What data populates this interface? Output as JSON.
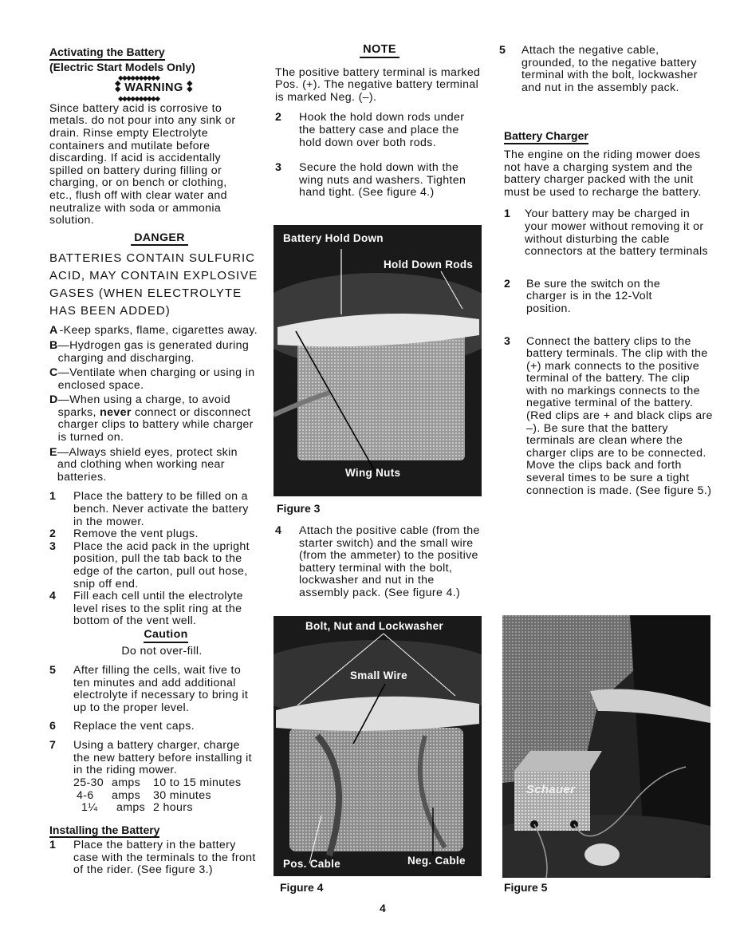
{
  "page_number": "4",
  "left_column": {
    "title": "Activating the Battery",
    "subtitle": "(Electric Start Models Only)",
    "warning_label": "WARNING",
    "warning_text": "Since battery acid is corrosive to metals. do not pour into any sink or drain. Rinse empty Electrolyte containers and mutilate before discarding. If acid is accidentally spilled on battery during filling or charging, or on bench or clothing, etc., flush off with clear water and neutralize with soda or ammonia solution.",
    "danger_label": "DANGER",
    "danger_text": "BATTERIES CONTAIN SULFURIC ACID, MAY CONTAIN EXPLOSIVE GASES (WHEN ELECTROLYTE HAS BEEN ADDED)",
    "danger_items": [
      {
        "letter": "A",
        "text": "-Keep sparks, flame, cigarettes away."
      },
      {
        "letter": "B",
        "text": "—Hydrogen gas is generated during charging and discharging."
      },
      {
        "letter": "C",
        "text": "—Ventilate when charging or using in enclosed space."
      },
      {
        "letter": "D",
        "text_before": "—When using a charge, to avoid sparks, ",
        "bold": "never",
        "text_after": " connect or disconnect charger clips to battery while charger is turned on."
      },
      {
        "letter": "E",
        "text": "—Always shield eyes, protect skin and clothing when working near batteries."
      }
    ],
    "steps": [
      {
        "num": "1",
        "text": "Place the battery to be filled on a bench. Never activate the battery in the mower."
      },
      {
        "num": "2",
        "text": "Remove the vent plugs."
      },
      {
        "num": "3",
        "text": "Place the acid pack in the upright position, pull the tab back to the edge of the carton, pull out hose, snip off end."
      },
      {
        "num": "4",
        "text": "Fill each cell until the electrolyte level rises to the split ring at the bottom of the vent well."
      }
    ],
    "caution_label": "Caution",
    "caution_text": "Do not over-fill.",
    "steps_b": [
      {
        "num": "5",
        "text": "After filling the cells, wait five to ten minutes and add additional electrolyte if necessary to bring it up to the proper level."
      },
      {
        "num": "6",
        "text": "Replace the vent caps."
      },
      {
        "num": "7",
        "text": "Using a battery charger, charge the new battery before installing it in the riding mower."
      }
    ],
    "charge_table": [
      {
        "amps": "25-30",
        "unit": "amps",
        "time": "10 to 15 minutes"
      },
      {
        "amps": "4-6",
        "unit": "amps",
        "time": "30 minutes"
      },
      {
        "amps": "1¼",
        "unit": "amps",
        "time": "2 hours"
      }
    ],
    "install_title": "Installing the Battery",
    "install_steps": [
      {
        "num": "1",
        "text": "Place the battery in the battery case with the terminals to the front of the rider. (See figure 3.)"
      }
    ]
  },
  "middle_column": {
    "note_label": "NOTE",
    "note_text": "The positive battery terminal is marked Pos. (+). The negative battery terminal is marked Neg. (–).",
    "steps": [
      {
        "num": "2",
        "text": "Hook the hold down rods under the battery case and place the hold down over both rods."
      },
      {
        "num": "3",
        "text": "Secure the hold down with the wing nuts and washers. Tighten hand tight. (See figure 4.)"
      }
    ],
    "figure3": {
      "caption": "Figure 3",
      "labels": {
        "hold_down": "Battery Hold Down",
        "rods": "Hold Down Rods",
        "wing_nuts": "Wing Nuts"
      }
    },
    "steps_b": [
      {
        "num": "4",
        "text": "Attach the positive cable (from the starter switch) and the small wire (from the ammeter) to the positive battery terminal with the bolt, lockwasher and nut in the assembly pack. (See figure 4.)"
      }
    ],
    "figure4": {
      "caption": "Figure 4",
      "labels": {
        "bolt": "Bolt, Nut and Lockwasher",
        "small_wire": "Small Wire",
        "pos_cable": "Pos. Cable",
        "neg_cable": "Neg. Cable"
      }
    }
  },
  "right_column": {
    "steps": [
      {
        "num": "5",
        "text": "Attach the negative cable, grounded, to the negative battery terminal with the bolt, lockwasher and nut in the assembly pack."
      }
    ],
    "charger_title": "Battery Charger",
    "charger_text": "The engine on the riding mower does not have a charging system and the battery charger packed with the unit must be used to recharge the battery.",
    "charger_steps": [
      {
        "num": "1",
        "text": "Your battery may be charged in your mower without removing it or without disturbing the cable connectors at the battery terminals"
      },
      {
        "num": "2",
        "text": "Be sure the switch on the charger is in the 12-Volt position."
      },
      {
        "num": "3",
        "text": "Connect the battery clips to the battery terminals. The clip with the (+) mark connects to the positive terminal of the battery. The clip with no markings connects to the negative terminal of the battery. (Red clips are + and black clips are –). Be sure that the battery terminals are clean where the charger clips are to be connected. Move the clips back and forth several times to be sure a tight connection is made. (See figure 5.)"
      }
    ],
    "figure5": {
      "caption": "Figure 5",
      "brand_label": "Schauer"
    }
  }
}
